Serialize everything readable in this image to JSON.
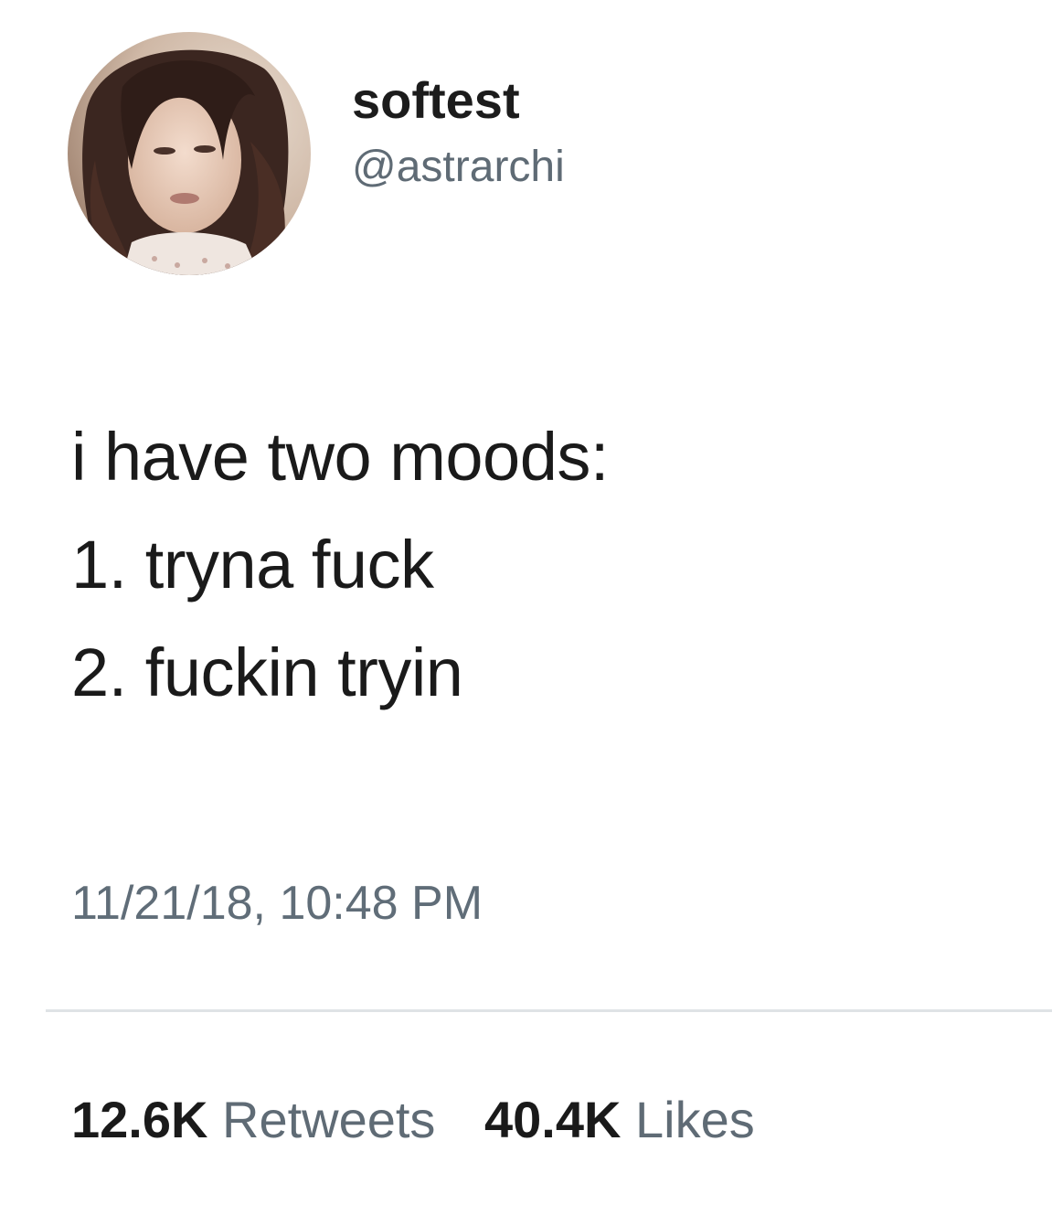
{
  "user": {
    "display_name": "softest",
    "handle": "@astrarchi"
  },
  "tweet": {
    "lines": [
      "i have two moods:",
      "1. tryna fuck",
      "2. fuckin tryin"
    ],
    "timestamp": "11/21/18, 10:48 PM"
  },
  "stats": {
    "retweets_count": "12.6K",
    "retweets_label": "Retweets",
    "likes_count": "40.4K",
    "likes_label": "Likes"
  },
  "colors": {
    "text": "#1a1a1a",
    "secondary": "#5f6b75",
    "divider": "#dfe3e6"
  }
}
